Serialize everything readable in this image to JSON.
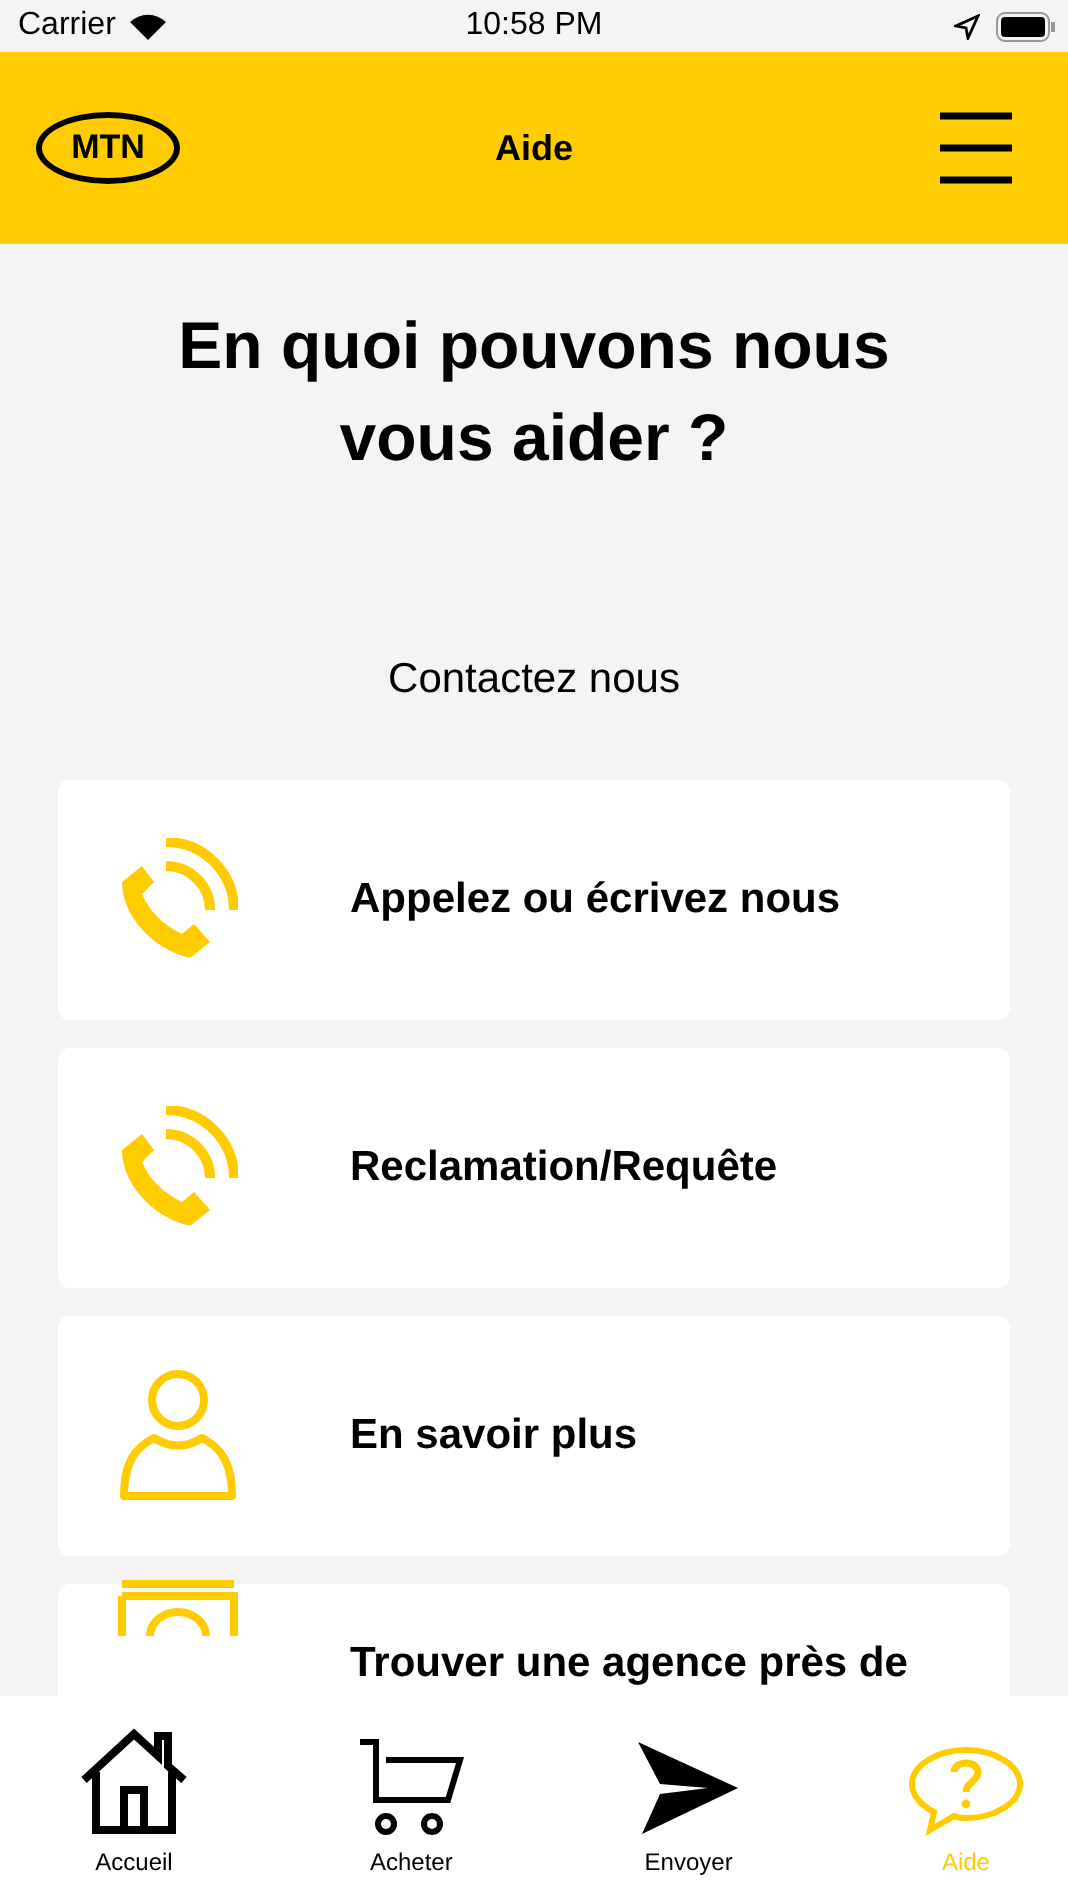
{
  "status_bar": {
    "carrier": "Carrier",
    "time": "10:58 PM"
  },
  "header": {
    "logo": "MTN",
    "title": "Aide"
  },
  "heading": "En quoi pouvons nous vous aider ?",
  "section_title": "Contactez nous",
  "cards": [
    {
      "kind": "phone",
      "label": "Appelez ou écrivez nous"
    },
    {
      "kind": "phone",
      "label": "Reclamation/Requête"
    },
    {
      "kind": "person",
      "label": "En savoir plus"
    },
    {
      "kind": "agency",
      "label": "Trouver une agence près de"
    }
  ],
  "tabs": [
    {
      "kind": "home",
      "label": "Accueil",
      "selected": false
    },
    {
      "kind": "cart",
      "label": "Acheter",
      "selected": false
    },
    {
      "kind": "send",
      "label": "Envoyer",
      "selected": false
    },
    {
      "kind": "help",
      "label": "Aide",
      "selected": true
    }
  ]
}
